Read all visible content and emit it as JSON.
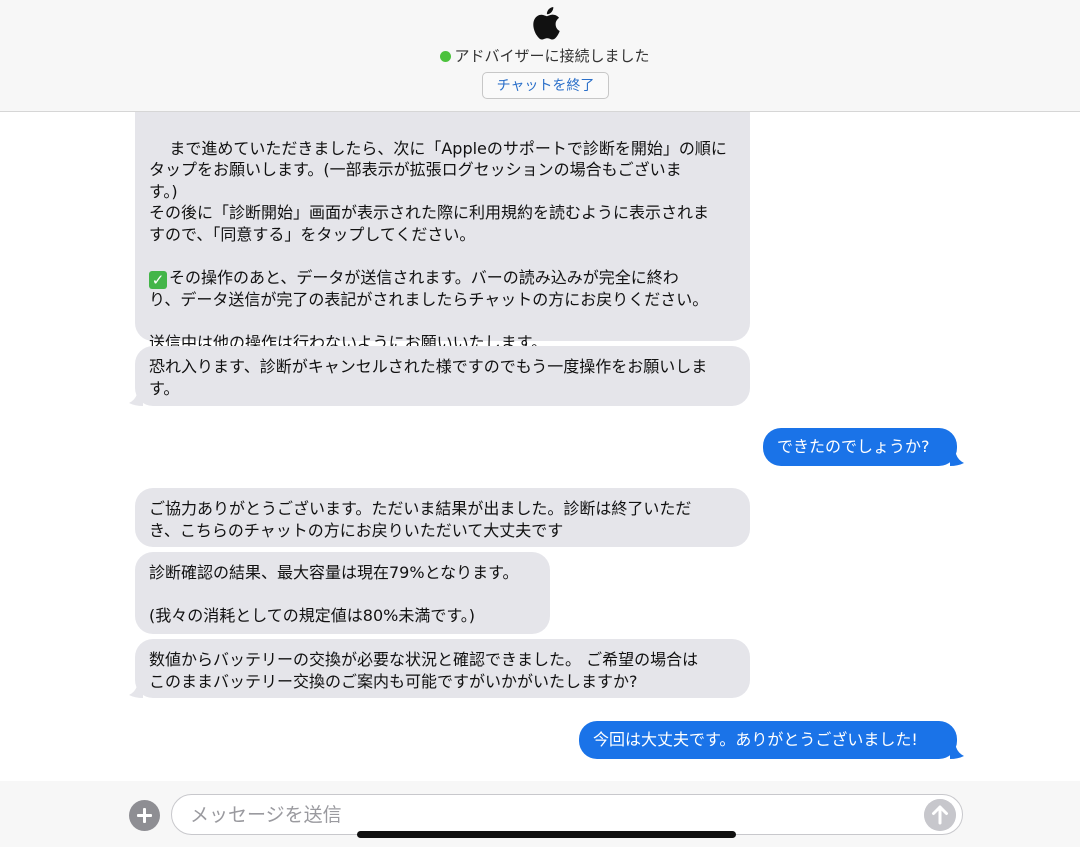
{
  "header": {
    "logo_icon": "apple-logo-icon",
    "status_text": "アドバイザーに接続しました",
    "status_color": "#4cc23d",
    "end_chat_label": "チャットを終了"
  },
  "messages": [
    {
      "sender": "advisor",
      "lines": [
        "まで進めていただきましたら、次に「Appleのサポートで診断を開始」の順に",
        "タップをお願いします。(一部表示が拡張ログセッションの場合もございま",
        "す。)",
        "その後に「診断開始」画面が表示された際に利用規約を読むように表示されま",
        "すので、「同意する」をタップしてください。",
        "",
        "その操作のあと、データが送信されます。バーの読み込みが完全に終わ",
        "り、データ送信が完了の表記がされましたらチャットの方にお戻りください。",
        "",
        "送信中は他の操作は行わないようにお願いいたします。"
      ]
    },
    {
      "sender": "advisor",
      "text": "恐れ入ります、診断がキャンセルされた様ですのでもう一度操作をお願いしま\nす。"
    },
    {
      "sender": "user",
      "text": "できたのでしょうか?"
    },
    {
      "sender": "advisor",
      "text": "ご協力ありがとうございます。ただいま結果が出ました。診断は終了いただ\nき、こちらのチャットの方にお戻りいただいて大丈夫です"
    },
    {
      "sender": "advisor",
      "text": "診断確認の結果、最大容量は現在79%となります。\n\n(我々の消耗としての規定値は80%未満です。)"
    },
    {
      "sender": "advisor",
      "text": "数値からバッテリーの交換が必要な状況と確認できました。 ご希望の場合は\nこのままバッテリー交換のご案内も可能ですがいかがいたしますか?"
    },
    {
      "sender": "user",
      "text": "今回は大丈夫です。ありがとうございました!"
    }
  ],
  "composer": {
    "add_icon": "plus-circle-icon",
    "placeholder": "メッセージを送信",
    "send_icon": "send-arrow-icon"
  },
  "colors": {
    "incoming_bubble": "#e5e5ea",
    "outgoing_bubble": "#1a73e8",
    "link_blue": "#2a6fc9"
  }
}
